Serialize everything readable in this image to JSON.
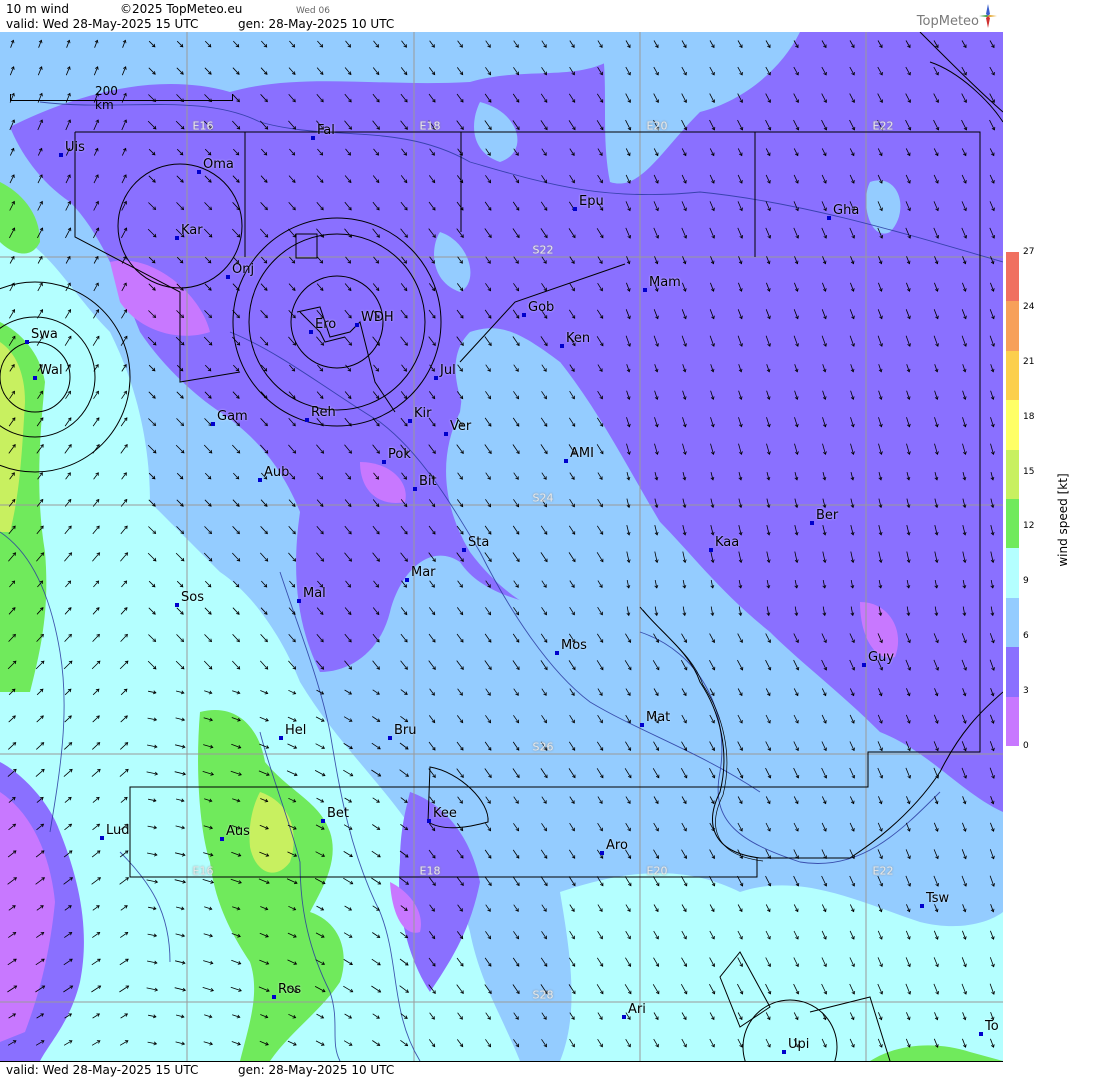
{
  "header": {
    "product": "10 m wind",
    "copyright": "©2025 TopMeteo.eu",
    "day_code": "Wed 06",
    "valid": "valid:  Wed  28-May-2025  15 UTC",
    "gen": "gen: 28-May-2025 10 UTC",
    "logo_text": "TopMeteo"
  },
  "footer": {
    "valid": "valid:  Wed  28-May-2025  15 UTC",
    "gen": "gen: 28-May-2025 10 UTC"
  },
  "scale": {
    "label": "200 km"
  },
  "grid_labels": {
    "lon_top": [
      "E16",
      "E18",
      "E20",
      "E22"
    ],
    "lat_mid": [
      "S22",
      "S24",
      "S26",
      "S28"
    ],
    "lon_bottom": [
      "E16",
      "E18",
      "E20",
      "E22"
    ]
  },
  "cities": [
    "Uis",
    "Oma",
    "Fal",
    "Epu",
    "Gha",
    "Kar",
    "Onj",
    "Swa",
    "Wal",
    "Ero",
    "WDH",
    "Gob",
    "Mam",
    "Ken",
    "Jul",
    "Gam",
    "Reh",
    "Kir",
    "Ver",
    "Pok",
    "AMI",
    "Bit",
    "Aub",
    "Ber",
    "Sta",
    "Kaa",
    "Sos",
    "Mal",
    "Mar",
    "Mos",
    "Guy",
    "Mat",
    "Hel",
    "Bru",
    "Bet",
    "Kee",
    "Lud",
    "Aus",
    "Aro",
    "Tsw",
    "Ros",
    "Ari",
    "Upi",
    "To"
  ],
  "legend": {
    "title": "wind speed [kt]",
    "ticks": [
      "27",
      "24",
      "21",
      "18",
      "15",
      "12",
      "9",
      "6",
      "3",
      "0"
    ],
    "colors": [
      "#f07060",
      "#f7a05a",
      "#fccf4d",
      "#ffff66",
      "#c8f060",
      "#70ea5c",
      "#b4ffff",
      "#94ccff",
      "#8a70ff",
      "#c878ff"
    ]
  }
}
